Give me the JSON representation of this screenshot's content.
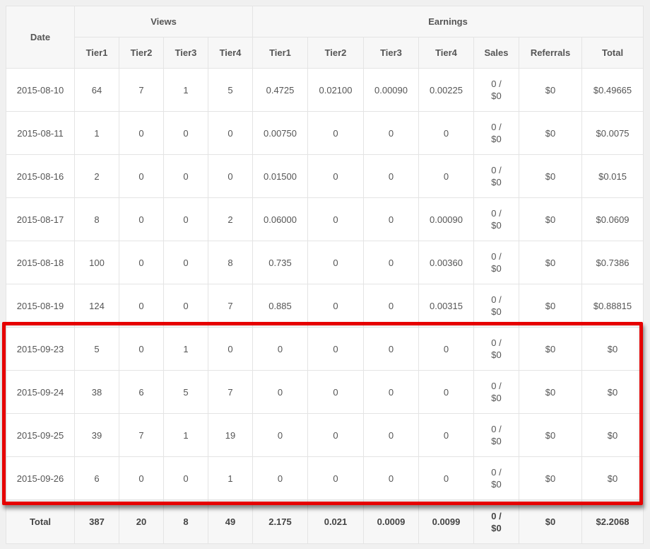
{
  "header": {
    "date": "Date",
    "views": "Views",
    "earnings": "Earnings",
    "views_tiers": [
      "Tier1",
      "Tier2",
      "Tier3",
      "Tier4"
    ],
    "earnings_tiers": [
      "Tier1",
      "Tier2",
      "Tier3",
      "Tier4"
    ],
    "sales": "Sales",
    "referrals": "Referrals",
    "total": "Total"
  },
  "rows": [
    {
      "date": "2015-08-10",
      "views": [
        "64",
        "7",
        "1",
        "5"
      ],
      "earnings": [
        "0.4725",
        "0.02100",
        "0.00090",
        "0.00225"
      ],
      "sales": [
        "0 /",
        "$0"
      ],
      "referrals": "$0",
      "total": "$0.49665"
    },
    {
      "date": "2015-08-11",
      "views": [
        "1",
        "0",
        "0",
        "0"
      ],
      "earnings": [
        "0.00750",
        "0",
        "0",
        "0"
      ],
      "sales": [
        "0 /",
        "$0"
      ],
      "referrals": "$0",
      "total": "$0.0075"
    },
    {
      "date": "2015-08-16",
      "views": [
        "2",
        "0",
        "0",
        "0"
      ],
      "earnings": [
        "0.01500",
        "0",
        "0",
        "0"
      ],
      "sales": [
        "0 /",
        "$0"
      ],
      "referrals": "$0",
      "total": "$0.015"
    },
    {
      "date": "2015-08-17",
      "views": [
        "8",
        "0",
        "0",
        "2"
      ],
      "earnings": [
        "0.06000",
        "0",
        "0",
        "0.00090"
      ],
      "sales": [
        "0 /",
        "$0"
      ],
      "referrals": "$0",
      "total": "$0.0609"
    },
    {
      "date": "2015-08-18",
      "views": [
        "100",
        "0",
        "0",
        "8"
      ],
      "earnings": [
        "0.735",
        "0",
        "0",
        "0.00360"
      ],
      "sales": [
        "0 /",
        "$0"
      ],
      "referrals": "$0",
      "total": "$0.7386"
    },
    {
      "date": "2015-08-19",
      "views": [
        "124",
        "0",
        "0",
        "7"
      ],
      "earnings": [
        "0.885",
        "0",
        "0",
        "0.00315"
      ],
      "sales": [
        "0 /",
        "$0"
      ],
      "referrals": "$0",
      "total": "$0.88815"
    },
    {
      "date": "2015-09-23",
      "views": [
        "5",
        "0",
        "1",
        "0"
      ],
      "earnings": [
        "0",
        "0",
        "0",
        "0"
      ],
      "sales": [
        "0 /",
        "$0"
      ],
      "referrals": "$0",
      "total": "$0"
    },
    {
      "date": "2015-09-24",
      "views": [
        "38",
        "6",
        "5",
        "7"
      ],
      "earnings": [
        "0",
        "0",
        "0",
        "0"
      ],
      "sales": [
        "0 /",
        "$0"
      ],
      "referrals": "$0",
      "total": "$0"
    },
    {
      "date": "2015-09-25",
      "views": [
        "39",
        "7",
        "1",
        "19"
      ],
      "earnings": [
        "0",
        "0",
        "0",
        "0"
      ],
      "sales": [
        "0 /",
        "$0"
      ],
      "referrals": "$0",
      "total": "$0"
    },
    {
      "date": "2015-09-26",
      "views": [
        "6",
        "0",
        "0",
        "1"
      ],
      "earnings": [
        "0",
        "0",
        "0",
        "0"
      ],
      "sales": [
        "0 /",
        "$0"
      ],
      "referrals": "$0",
      "total": "$0"
    }
  ],
  "totals": {
    "label": "Total",
    "views": [
      "387",
      "20",
      "8",
      "49"
    ],
    "earnings": [
      "2.175",
      "0.021",
      "0.0009",
      "0.0099"
    ],
    "sales": [
      "0 /",
      "$0"
    ],
    "referrals": "$0",
    "total": "$2.2068"
  },
  "colors": {
    "highlight": "#e60000",
    "header_bg": "#f7f7f7",
    "border": "#e4e4e4"
  }
}
